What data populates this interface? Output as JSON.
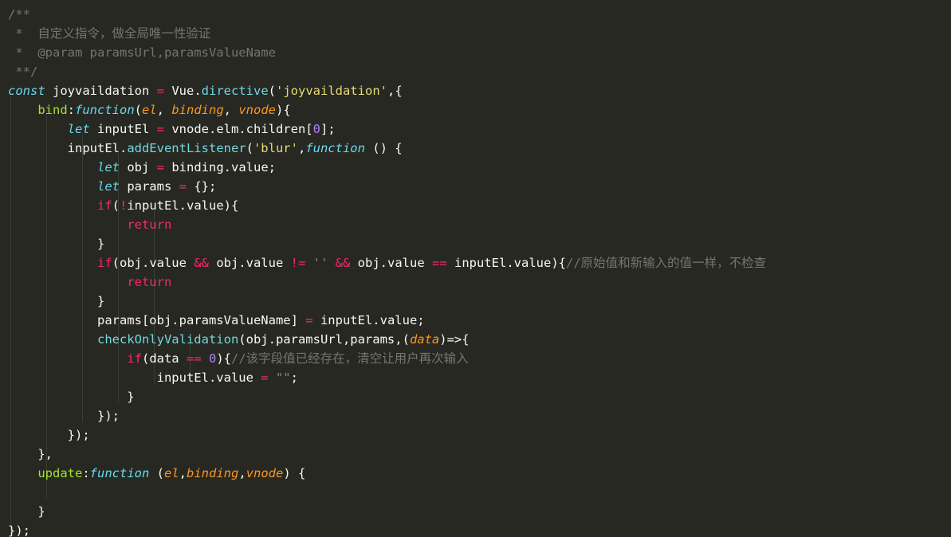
{
  "editor": {
    "theme": "monokai-dark",
    "background": "#272822",
    "foreground": "#f8f8f2",
    "language": "javascript",
    "font_size_px": 15.5,
    "line_height_px": 24,
    "indent_guide_color": "#3b3c35",
    "indent_guide_x": [
      13,
      58,
      103,
      148,
      193,
      238
    ],
    "colors": {
      "comment": "#75756b",
      "keyword": "#f92672",
      "storage": "#66d9ef",
      "function_call": "#6fd9e0",
      "property": "#a6e22e",
      "string": "#e6db74",
      "number": "#ae81ff",
      "parameter": "#fd971f",
      "plain": "#f8f8f2",
      "dim_string": "#8a8577"
    }
  },
  "code": {
    "line_count": 28,
    "lines": [
      "/**",
      " *  自定义指令，做全局唯一性验证",
      " *  @param paramsUrl,paramsValueName",
      " **/",
      "const joyvaildation = Vue.directive('joyvaildation',{",
      "    bind:function(el, binding, vnode){",
      "        let inputEl = vnode.elm.children[0];",
      "        inputEl.addEventListener('blur',function () {",
      "            let obj = binding.value;",
      "            let params = {};",
      "            if(!inputEl.value){",
      "                return",
      "            }",
      "            if(obj.value && obj.value != '' && obj.value == inputEl.value){//原始值和新输入的值一样，不检查",
      "                return",
      "            }",
      "            params[obj.paramsValueName] = inputEl.value;",
      "            checkOnlyValidation(obj.paramsUrl,params,(data)=>{",
      "                if(data == 0){//该字段值已经存在，清空让用户再次输入",
      "                    inputEl.value = \"\";",
      "                }",
      "            });",
      "        });",
      "    },",
      "    update:function (el,binding,vnode) {",
      "",
      "    }",
      "});"
    ],
    "comments": [
      "/**",
      " *  自定义指令，做全局唯一性验证",
      " *  @param paramsUrl,paramsValueName",
      " **/",
      "//原始值和新输入的值一样，不检查",
      "//该字段值已经存在，清空让用户再次输入"
    ],
    "identifiers": {
      "directive_name": "joyvaildation",
      "global_object": "Vue",
      "directive_method": "directive",
      "hooks": [
        "bind",
        "update"
      ],
      "parameters": [
        "el",
        "binding",
        "vnode",
        "data"
      ],
      "locals": [
        "inputEl",
        "obj",
        "params"
      ],
      "event_name": "blur",
      "dom_path": "vnode.elm.children[0]",
      "validation_fn": "checkOnlyValidation",
      "binding_props": [
        "value",
        "paramsUrl",
        "paramsValueName"
      ],
      "empty_value": "\"\"",
      "zero": "0"
    }
  }
}
